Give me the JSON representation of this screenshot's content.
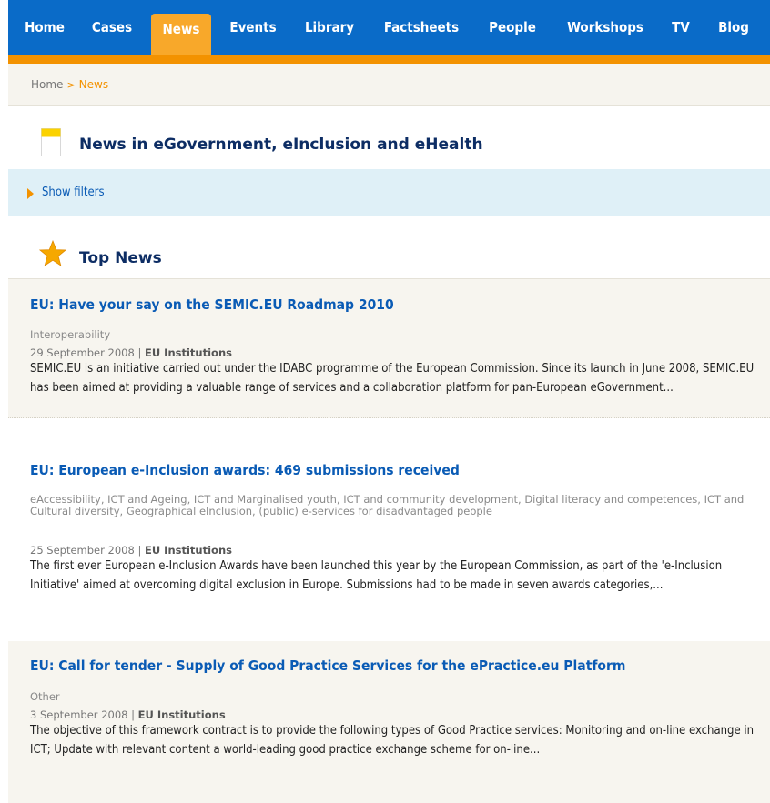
{
  "nav": {
    "items": [
      {
        "label": "Home",
        "active": false
      },
      {
        "label": "Cases",
        "active": false
      },
      {
        "label": "News",
        "active": true
      },
      {
        "label": "Events",
        "active": false
      },
      {
        "label": "Library",
        "active": false
      },
      {
        "label": "Factsheets",
        "active": false
      },
      {
        "label": "People",
        "active": false
      },
      {
        "label": "Workshops",
        "active": false
      },
      {
        "label": "TV",
        "active": false
      },
      {
        "label": "Blog",
        "active": false
      }
    ],
    "color": "#0a6bc8",
    "accent": "#f39200"
  },
  "breadcrumb": {
    "home": "Home",
    "separator": ">",
    "current": "News"
  },
  "page_heading": {
    "title": "News in eGovernment, eInclusion and eHealth",
    "icon": "document-icon"
  },
  "filters": {
    "label": "Show filters",
    "icon": "triangle-right-icon"
  },
  "top_news": {
    "title": "Top News",
    "icon": "star-icon"
  },
  "news": [
    {
      "title": "EU: Have your say on the SEMIC.EU Roadmap 2010",
      "tags": "Interoperability",
      "date": "29 September 2008",
      "date_sep": "|",
      "source": "EU Institutions",
      "body": "SEMIC.EU is an initiative carried out under the IDABC programme of the European Commission. Since its launch in June 2008, SEMIC.EU has been aimed at providing a valuable range of services and a collaboration platform for pan-European eGovernment..."
    },
    {
      "title": "EU: European e-Inclusion awards: 469 submissions received",
      "tags": "eAccessibility, ICT and Ageing, ICT and Marginalised youth, ICT and community development, Digital literacy and competences, ICT and Cultural diversity, Geographical eInclusion, (public) e-services for disadvantaged people",
      "date": "25 September 2008",
      "date_sep": "|",
      "source": "EU Institutions",
      "body": "The first ever European e-Inclusion Awards have been launched this year by the European Commission, as part of the 'e-Inclusion Initiative' aimed at overcoming digital exclusion in Europe. Submissions had to be made in seven awards categories,..."
    },
    {
      "title": "EU: Call for tender - Supply of Good Practice Services for the ePractice.eu Platform",
      "tags": "Other",
      "date": "3 September 2008",
      "date_sep": "|",
      "source": "EU Institutions",
      "body": "The objective of this framework contract is to provide the following types of Good Practice services: Monitoring and on-line exchange in ICT; Update with relevant content a world-leading good practice exchange scheme for on-line..."
    }
  ]
}
